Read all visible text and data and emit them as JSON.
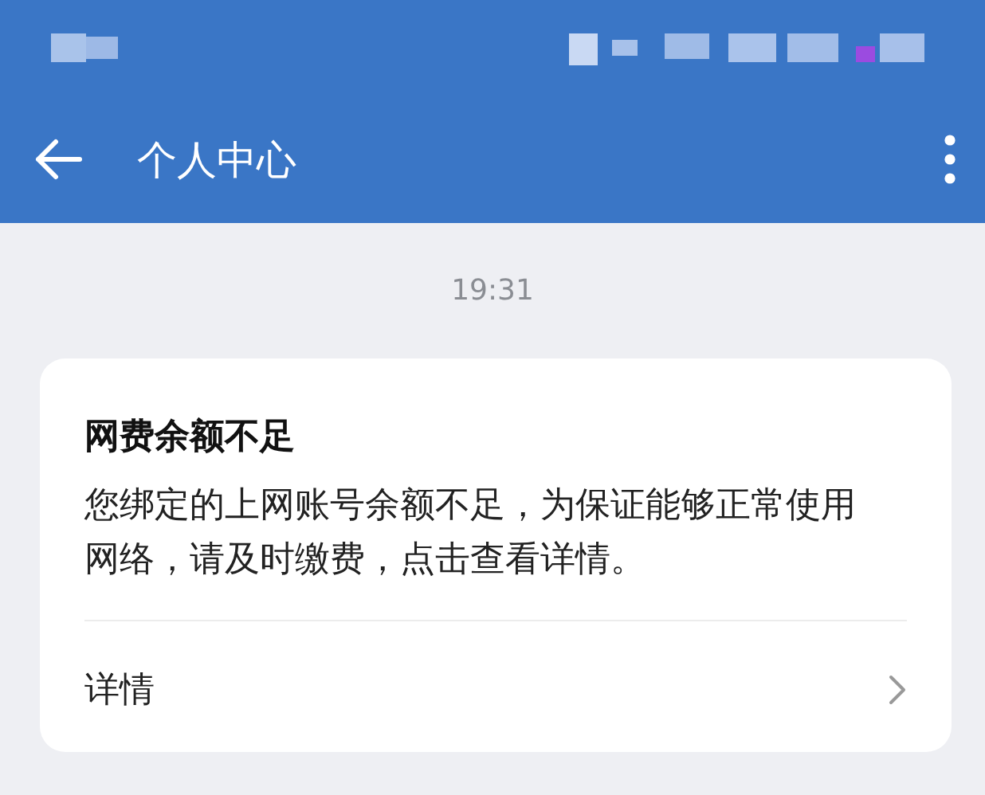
{
  "app_bar": {
    "title": "个人中心"
  },
  "timestamp": "19:31",
  "notice": {
    "title": "网费余额不足",
    "body": "您绑定的上网账号余额不足，为保证能够正常使用网络，请及时缴费，点击查看详情。",
    "link": "详情"
  }
}
